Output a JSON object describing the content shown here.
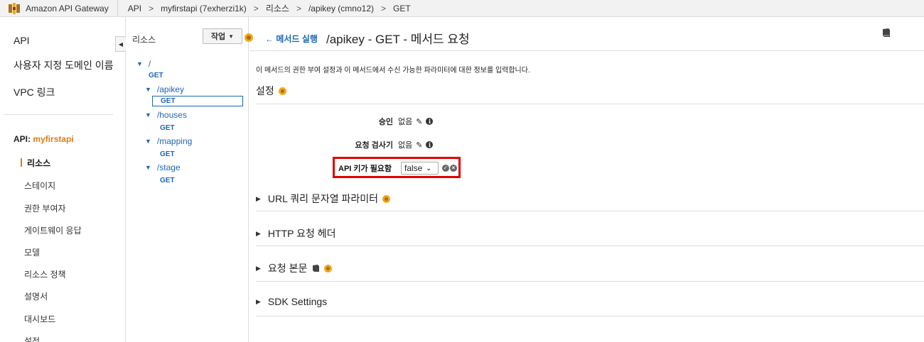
{
  "topbar": {
    "service_name": "Amazon API Gateway",
    "crumbs": [
      "API",
      ">",
      "myfirstapi (7exherzi1k)",
      ">",
      "리소스",
      ">",
      "/apikey (cmno12)",
      ">",
      "GET"
    ]
  },
  "leftnav": {
    "items": [
      "API",
      "사용자 지정 도메인 이름",
      "VPC 링크"
    ],
    "api_prefix": "API: ",
    "api_name": "myfirstapi",
    "sub_items": [
      "리소스",
      "스테이지",
      "권한 부여자",
      "게이트웨이 응답",
      "모델",
      "리소스 정책",
      "설명서",
      "대시보드",
      "설정"
    ],
    "active_sub_item": "리소스",
    "collapse_icon": "caret-left-icon"
  },
  "tree": {
    "title": "리소스",
    "action_label": "작업",
    "nodes": [
      {
        "path": "/",
        "method": "GET"
      },
      {
        "path": "/apikey",
        "method": "GET",
        "selected": true
      },
      {
        "path": "/houses",
        "method": "GET"
      },
      {
        "path": "/mapping",
        "method": "GET"
      },
      {
        "path": "/stage",
        "method": "GET"
      }
    ]
  },
  "main": {
    "back_label": "← 메서드 실행",
    "title": "/apikey - GET - 메서드 요청",
    "description": "이 메서드의 권한 부여 설정과 이 메서드에서 수신 가능한 파라미터에 대한 정보를 입력합니다.",
    "settings_title": "설정",
    "properties": {
      "auth_label": "승인",
      "auth_value": "없음",
      "validator_label": "요청 검사기",
      "validator_value": "없음",
      "apikey_label": "API 키가 필요함",
      "apikey_value": "false"
    },
    "sections": [
      "URL 쿼리 문자열 파라미터",
      "HTTP 요청 헤더",
      "요청 본문",
      "SDK Settings"
    ],
    "colors": {
      "link": "#1f66b5",
      "accent": "#e07b16",
      "highlight": "#e00000"
    }
  }
}
